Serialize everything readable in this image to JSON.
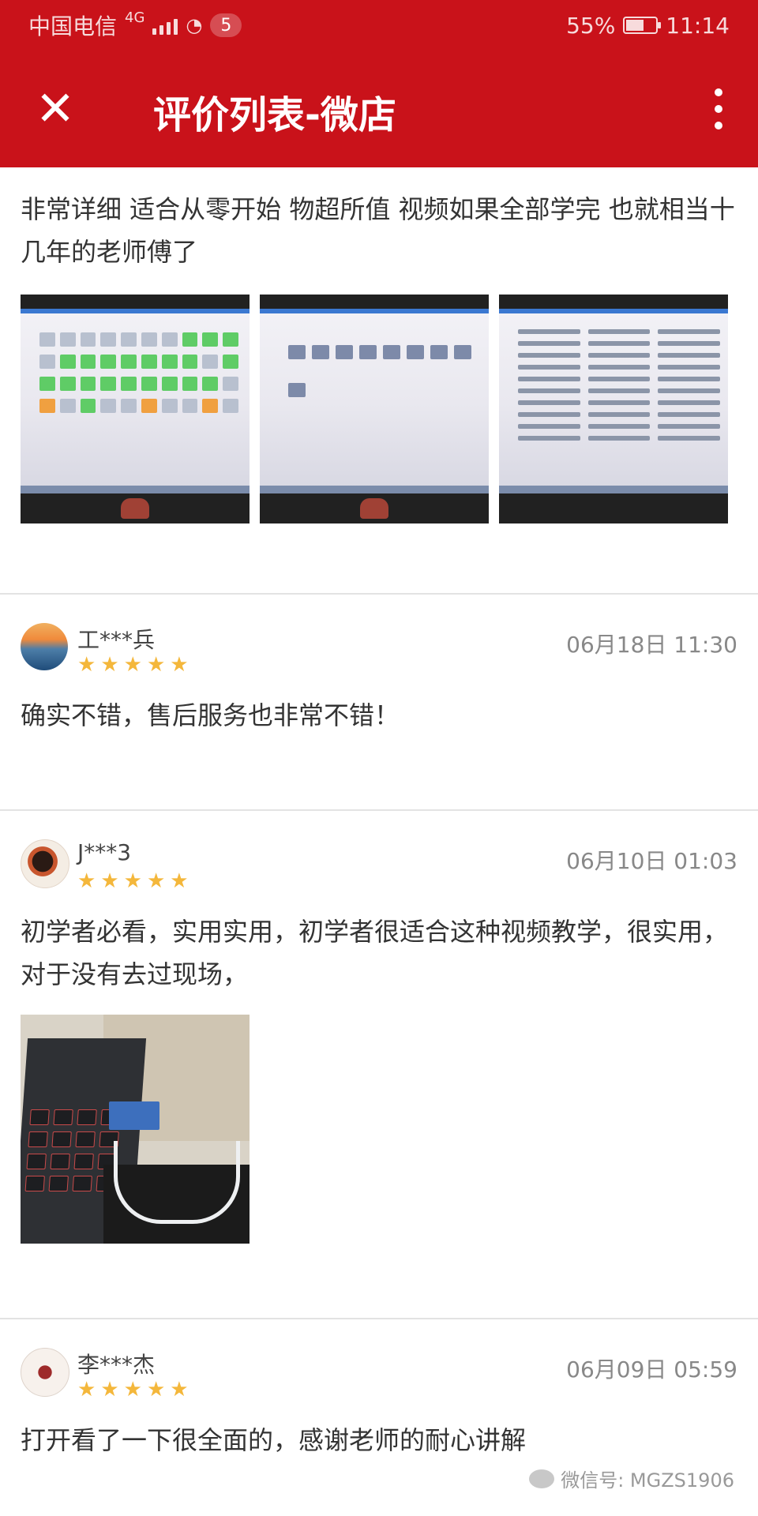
{
  "status_bar": {
    "carrier": "中国电信",
    "network": "4G",
    "badge": "5",
    "battery": "55%",
    "time": "11:14"
  },
  "nav": {
    "title": "评价列表-微店",
    "close_icon": "✕"
  },
  "reviews": [
    {
      "text": "非常详细 适合从零开始 物超所值 视频如果全部学完 也就相当十几年的老师傅了",
      "images": 3
    },
    {
      "user": "工***兵",
      "time": "06月18日 11:30",
      "rating": 5,
      "text": "确实不错，售后服务也非常不错！"
    },
    {
      "user": "J***3",
      "time": "06月10日 01:03",
      "rating": 5,
      "text": "初学者必看，实用实用，初学者很适合这种视频教学，很实用，对于没有去过现场，",
      "images": 1
    },
    {
      "user": "李***杰",
      "time": "06月09日 05:59",
      "rating": 5,
      "text": "打开看了一下很全面的，感谢老师的耐心讲解"
    }
  ],
  "watermark": "微信号: MGZS1906",
  "colors": {
    "header": "#c9121a",
    "star": "#f4b73b"
  }
}
